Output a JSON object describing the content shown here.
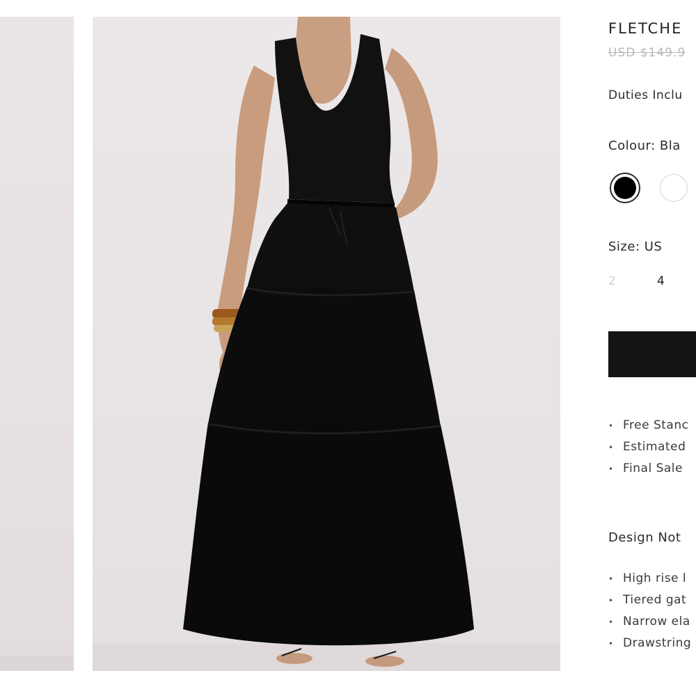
{
  "product": {
    "title": "FLETCHE",
    "price": "USD $149.9",
    "duties": "Duties Inclu",
    "colour_label": "Colour: Bla",
    "colours": [
      {
        "name": "black",
        "hex": "#000000",
        "selected": true
      },
      {
        "name": "white",
        "hex": "#ffffff",
        "selected": false
      }
    ],
    "size_label": "Size: US",
    "sizes": [
      {
        "label": "2",
        "available": false
      },
      {
        "label": "4",
        "available": true
      }
    ],
    "add_to_cart_label": ""
  },
  "shipping_bullets": [
    "Free Stanc",
    "Estimated",
    "Final Sale"
  ],
  "design_notes": {
    "title": "Design Not",
    "items": [
      "High rise l",
      "Tiered gat",
      "Narrow ela",
      "Drawstring"
    ]
  },
  "colors": {
    "button": "#141414",
    "photo_bg": "#e9e5e6",
    "garment": "#0d0d0d"
  }
}
